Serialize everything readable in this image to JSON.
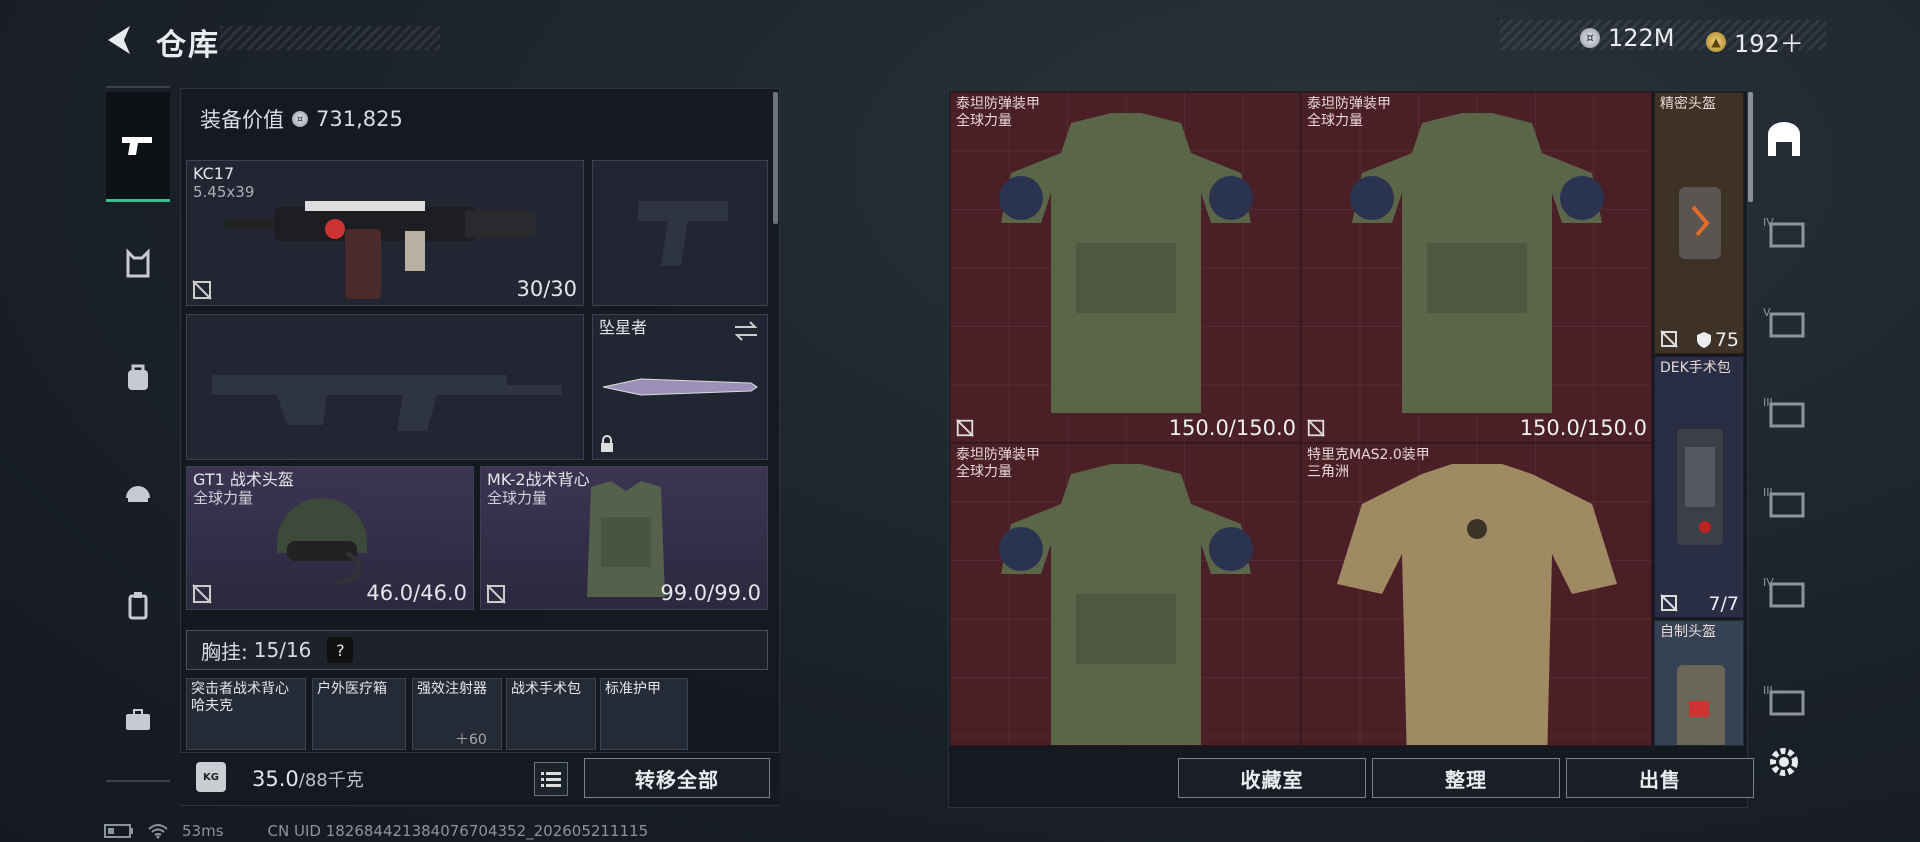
{
  "header": {
    "title": "仓库",
    "silver_amount": "122M",
    "gold_amount": "192＋"
  },
  "left": {
    "equip_value_label": "装备价值",
    "equip_value": "731,825",
    "primary_weapon": {
      "name": "KC17",
      "caliber": "5.45x39",
      "ammo": "30/30"
    },
    "melee": {
      "name": "坠星者"
    },
    "helmet": {
      "name": "GT1 战术头盔",
      "faction": "全球力量",
      "durability": "46.0/46.0"
    },
    "armor": {
      "name": "MK-2战术背心",
      "faction": "全球力量",
      "durability": "99.0/99.0"
    },
    "rig": {
      "label": "胸挂:",
      "capacity": "15/16",
      "help": "?"
    },
    "rig_items": [
      {
        "name": "突击者战术背心\n哈夫克"
      },
      {
        "name": "户外医疗箱"
      },
      {
        "name": "强效注射器",
        "count": "60"
      },
      {
        "name": "战术手术包"
      },
      {
        "name": "标准护甲"
      }
    ],
    "weight": "35.0",
    "weight_max": "/88千克",
    "transfer_all": "转移全部"
  },
  "stash": {
    "items": [
      {
        "name": "泰坦防弹装甲",
        "faction": "全球力量",
        "durability": "150.0/150.0"
      },
      {
        "name": "泰坦防弹装甲",
        "faction": "全球力量",
        "durability": "150.0/150.0"
      },
      {
        "name": "泰坦防弹装甲",
        "faction": "全球力量",
        "durability": ""
      },
      {
        "name": "特里克MAS2.0装甲",
        "faction": "三角洲",
        "durability": ""
      }
    ],
    "side_items": [
      {
        "name": "精密头盔",
        "armor_value": "75"
      },
      {
        "name": "DEK手术包",
        "uses": "7/7"
      },
      {
        "name": "自制头盔"
      }
    ],
    "buttons": {
      "collection": "收藏室",
      "sort": "整理",
      "sell": "出售"
    }
  },
  "status_bar": {
    "ping": "53ms",
    "uid": "CN UID 1826844213840767043​52_202605211115"
  },
  "colors": {
    "accent_green": "#36c28f",
    "stash_red": "#4a1f26",
    "purple_slot": "#423a5c"
  }
}
